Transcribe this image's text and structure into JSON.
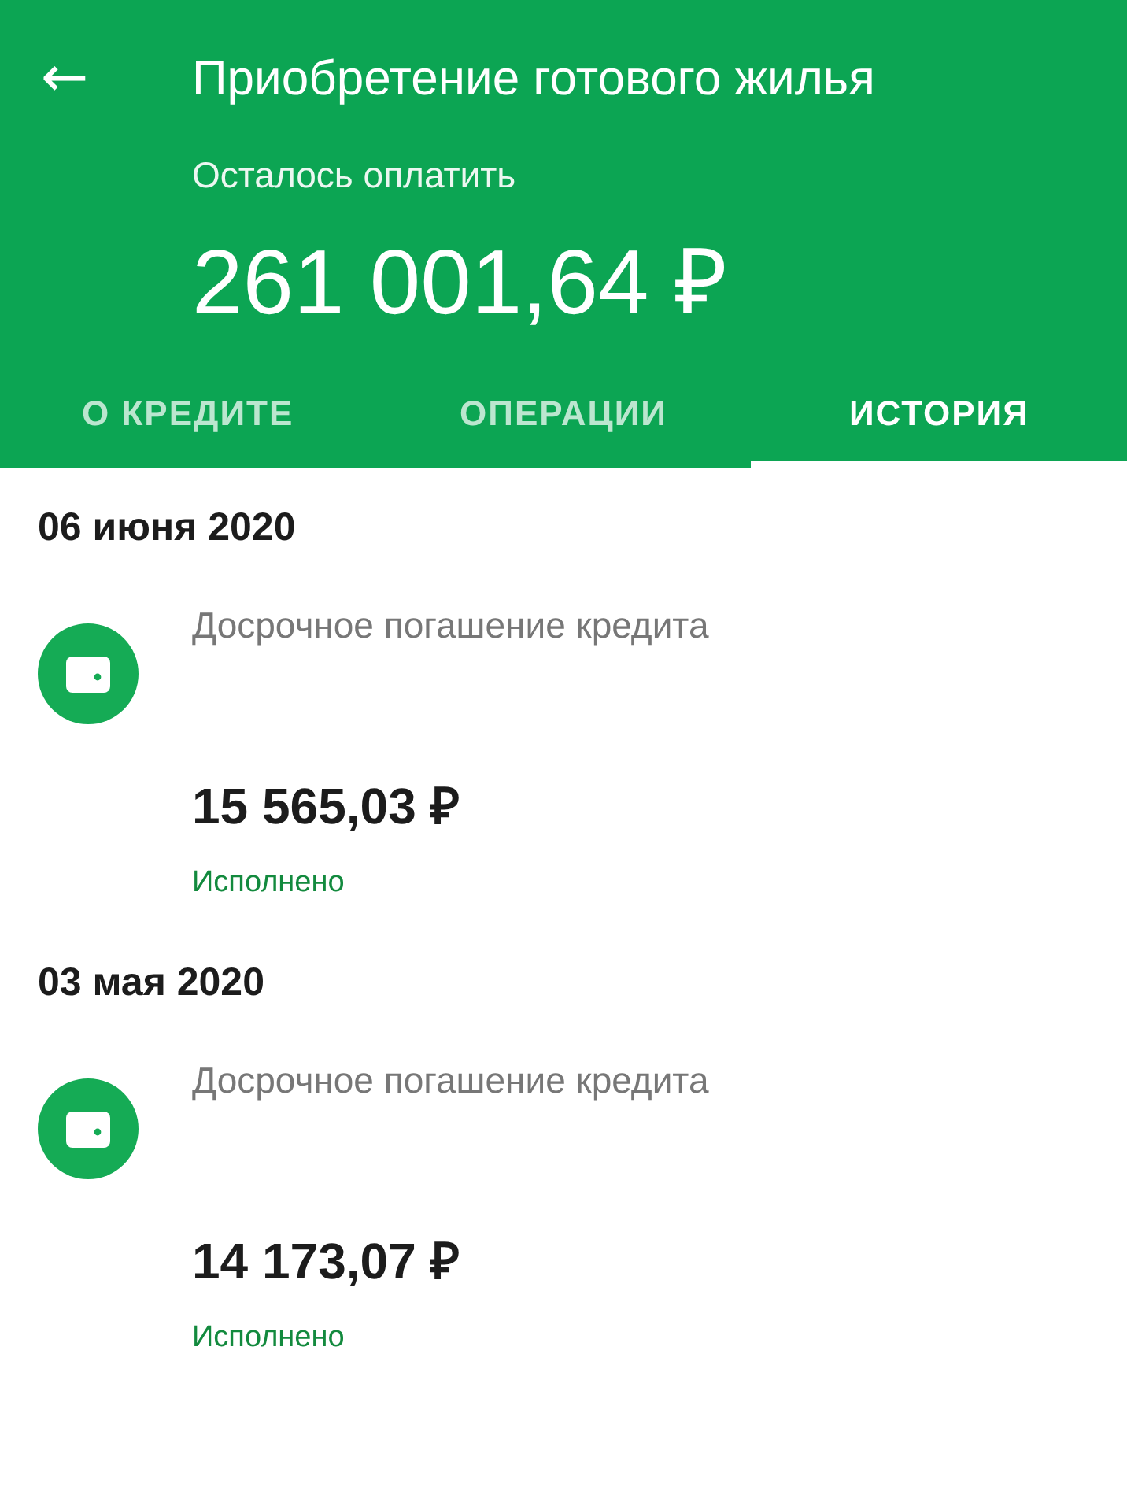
{
  "header": {
    "back": "←",
    "title": "Приобретение готового жилья",
    "remaining_label": "Осталось оплатить",
    "remaining_amount": "261 001,64 ₽"
  },
  "tabs": [
    {
      "label": "О КРЕДИТЕ",
      "selected": false
    },
    {
      "label": "ОПЕРАЦИИ",
      "selected": false
    },
    {
      "label": "ИСТОРИЯ",
      "selected": true
    }
  ],
  "history": [
    {
      "date": "06 июня 2020",
      "description": "Досрочное погашение кредита",
      "amount": "15 565,03 ₽",
      "status": "Исполнено"
    },
    {
      "date": "03 мая 2020",
      "description": "Досрочное погашение кредита",
      "amount": "14 173,07 ₽",
      "status": "Исполнено"
    }
  ]
}
